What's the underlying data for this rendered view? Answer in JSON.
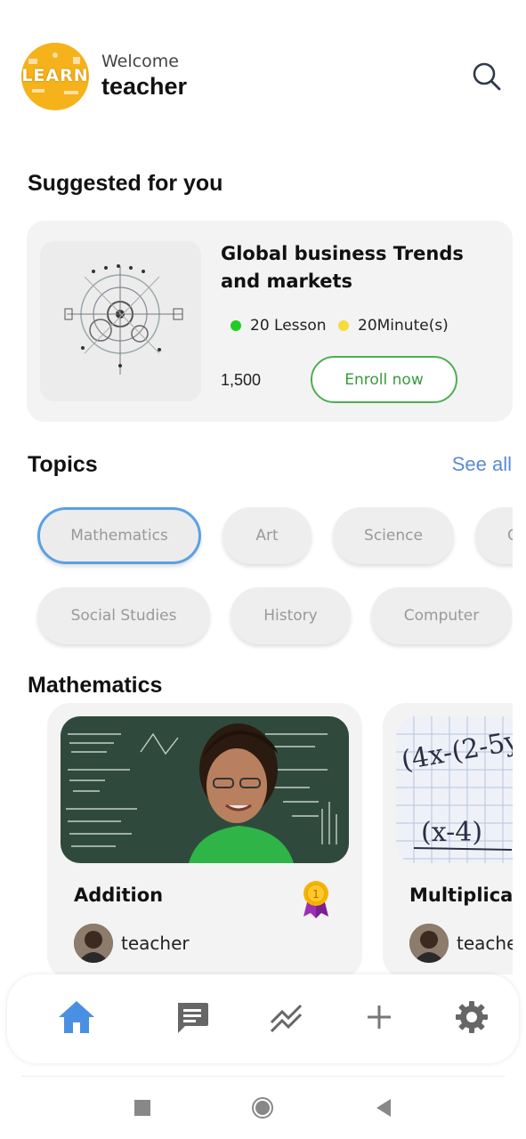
{
  "header": {
    "logo_text": "LEARN",
    "welcome": "Welcome",
    "username": "teacher",
    "search_icon": "search-icon"
  },
  "suggested": {
    "title": "Suggested for you",
    "course": {
      "title": "Global business Trends and markets",
      "lessons": "20 Lesson",
      "duration": "20Minute(s)",
      "price": "1,500",
      "enroll_label": "Enroll now"
    }
  },
  "topics": {
    "title": "Topics",
    "see_all": "See all",
    "row1": [
      "Mathematics",
      "Art",
      "Science",
      "C"
    ],
    "row2": [
      "Social Studies",
      "History",
      "Computer"
    ],
    "selected": "Mathematics"
  },
  "mathematics": {
    "title": "Mathematics",
    "courses": [
      {
        "title": "Addition",
        "teacher": "teacher",
        "medal": "1"
      },
      {
        "title": "Multiplicat",
        "teacher": "teache"
      }
    ]
  },
  "bottom_nav": {
    "items": [
      "home-icon",
      "chat-icon",
      "trending-icon",
      "add-icon",
      "settings-icon"
    ],
    "active": "home-icon"
  },
  "colors": {
    "accent_blue": "#5aa0e6",
    "nav_active": "#4a90e2",
    "enroll_green": "#4caf50",
    "lesson_dot": "#22cc22",
    "duration_dot": "#f5dc3a",
    "card_bg": "#f3f3f3"
  }
}
